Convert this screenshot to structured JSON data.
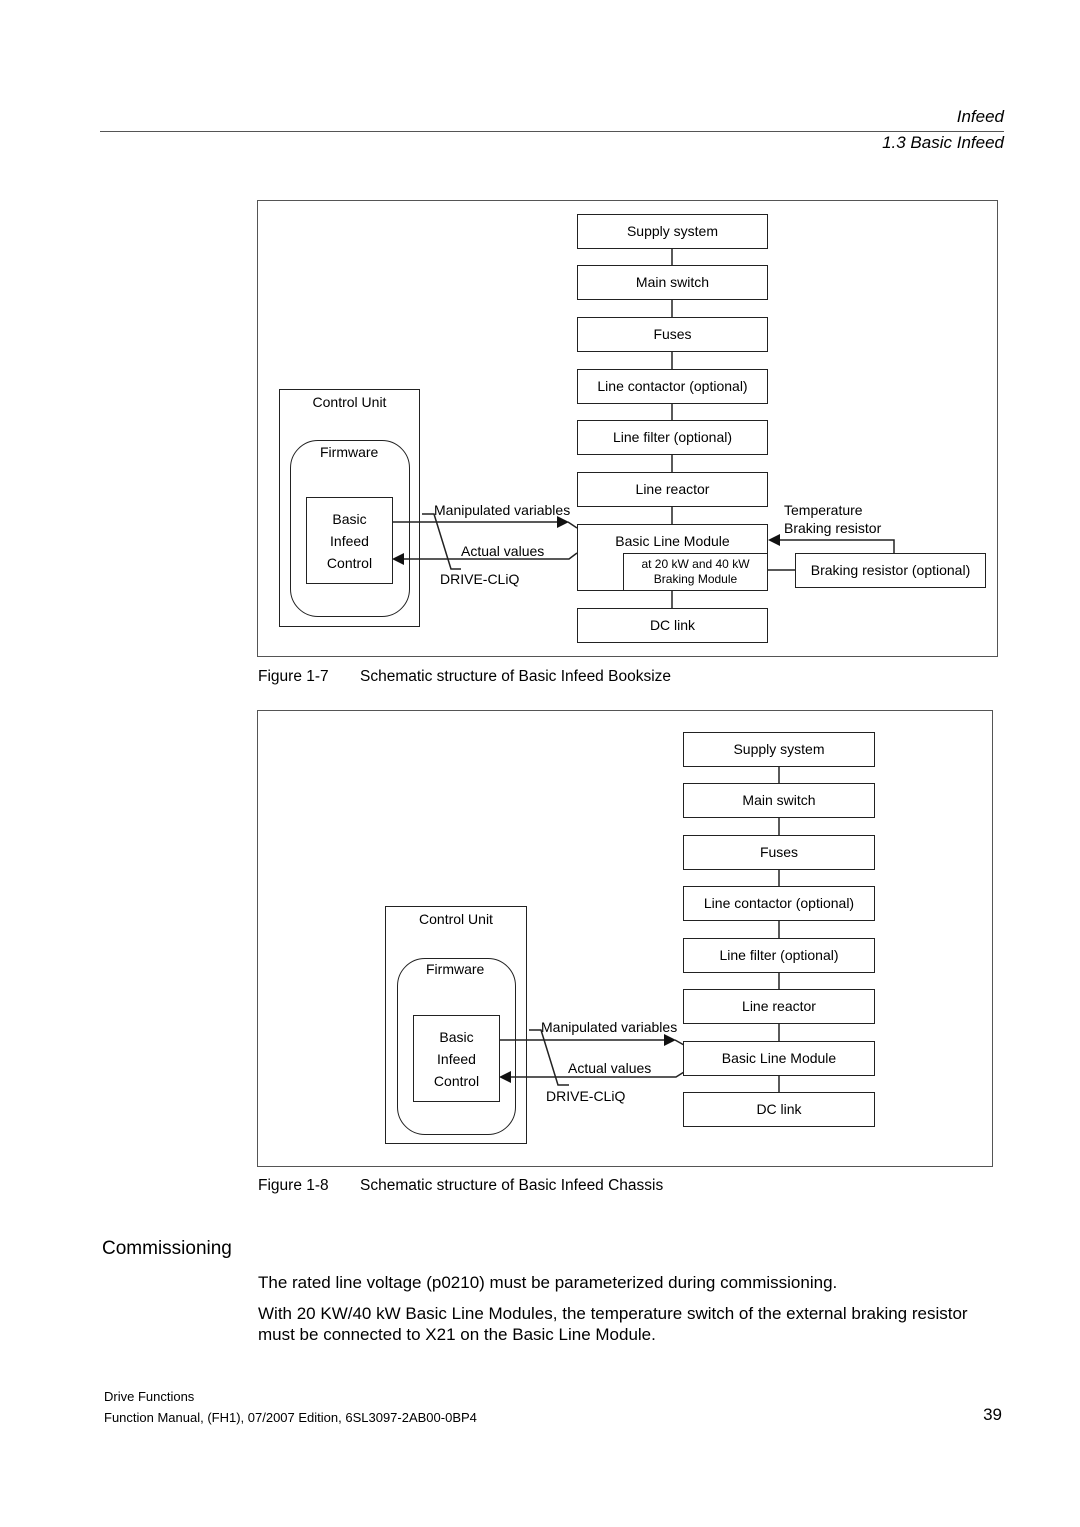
{
  "header": {
    "chapter": "Infeed",
    "section": "1.3 Basic Infeed"
  },
  "figure1": {
    "number": "Figure 1-7",
    "caption": "Schematic structure of Basic Infeed Booksize",
    "chain": [
      "Supply system",
      "Main switch",
      "Fuses",
      "Line contactor (optional)",
      "Line filter (optional)",
      "Line reactor",
      "Basic Line Module",
      "DC link"
    ],
    "braking_module": [
      "at 20 kW and 40 kW",
      "Braking Module"
    ],
    "braking_resistor": "Braking resistor (optional)",
    "temperature_label": [
      "Temperature",
      "Braking resistor"
    ],
    "control_unit": "Control Unit",
    "firmware": "Firmware",
    "control_block": [
      "Basic",
      "Infeed",
      "Control"
    ],
    "manipulated": "Manipulated variables",
    "actual": "Actual values",
    "bus": "DRIVE-CLiQ"
  },
  "figure2": {
    "number": "Figure 1-8",
    "caption": "Schematic structure of Basic Infeed Chassis",
    "chain": [
      "Supply system",
      "Main switch",
      "Fuses",
      "Line contactor (optional)",
      "Line filter (optional)",
      "Line reactor",
      "Basic Line Module",
      "DC link"
    ],
    "control_unit": "Control Unit",
    "firmware": "Firmware",
    "control_block": [
      "Basic",
      "Infeed",
      "Control"
    ],
    "manipulated": "Manipulated variables",
    "actual": "Actual values",
    "bus": "DRIVE-CLiQ"
  },
  "commissioning": {
    "heading": "Commissioning",
    "paragraphs": [
      "The rated line voltage (p0210) must be parameterized during commissioning.",
      "With 20 KW/40 kW Basic Line Modules, the temperature switch of the external braking resistor must be connected to X21 on the Basic Line Module."
    ]
  },
  "footer": {
    "line1": "Drive Functions",
    "line2": "Function Manual, (FH1), 07/2007 Edition, 6SL3097-2AB00-0BP4",
    "page": "39"
  }
}
